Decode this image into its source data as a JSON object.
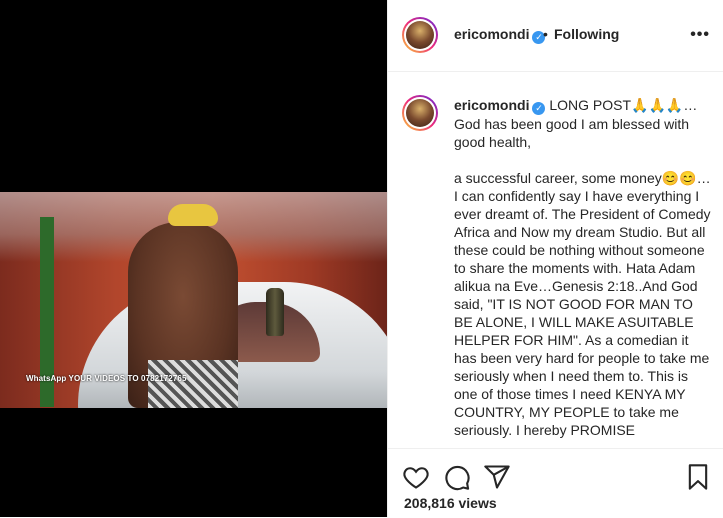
{
  "post": {
    "watermark": "WhatsApp YOUR VIDEOS TO 0782172765"
  },
  "header": {
    "username": "ericomondi",
    "separator": "•",
    "follow_status": "Following",
    "more": "•••"
  },
  "caption": {
    "username": "ericomondi",
    "line1": " LONG POST🙏🙏🙏…God has been good I am blessed with good health,",
    "line2": "a successful career, some money😊😊…I can confidently say I have everything I ever dreamt of. The President of Comedy Africa and Now my dream Studio. But all these could be nothing without someone to share the moments with. Hata Adam alikua na Eve…Genesis 2:18..And God said, \"IT IS NOT GOOD FOR MAN TO BE ALONE, I WILL MAKE ASUITABLE HELPER FOR HIM\". As a comedian it has been very hard for people to take me seriously when I need them to. This is one of those times I need KENYA MY COUNTRY, MY PEOPLE to take me seriously. I hereby PROMISE"
  },
  "footer": {
    "views": "208,816 views"
  },
  "icons": {
    "like": "heart-icon",
    "comment": "comment-icon",
    "share": "share-icon",
    "save": "bookmark-icon"
  },
  "colors": {
    "verified": "#3897f0",
    "text": "#262626",
    "divider": "#efefef"
  }
}
